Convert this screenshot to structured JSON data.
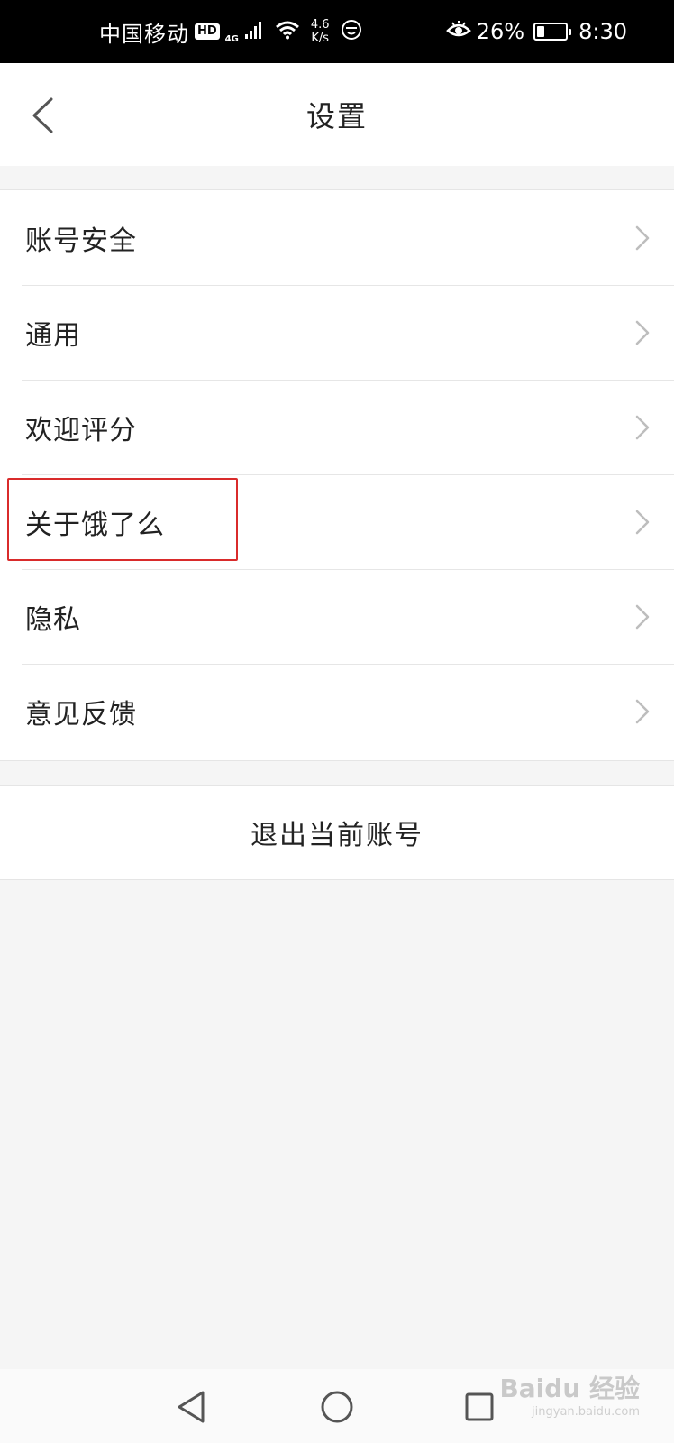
{
  "status_bar": {
    "carrier": "中国移动",
    "hd_badge": "HD",
    "network_type": "4G",
    "speed_value": "4.6",
    "speed_unit": "K/s",
    "battery_percent": "26%",
    "battery_level": 0.26,
    "time": "8:30"
  },
  "header": {
    "title": "设置"
  },
  "menu": {
    "items": [
      {
        "label": "账号安全"
      },
      {
        "label": "通用"
      },
      {
        "label": "欢迎评分"
      },
      {
        "label": "关于饿了么"
      },
      {
        "label": "隐私"
      },
      {
        "label": "意见反馈"
      }
    ]
  },
  "logout": {
    "label": "退出当前账号"
  },
  "watermark": {
    "brand": "Baidu 经验",
    "url": "jingyan.baidu.com"
  },
  "colors": {
    "highlight": "#d92b2b",
    "background": "#f5f5f5",
    "chevron": "#bdbdbd"
  }
}
